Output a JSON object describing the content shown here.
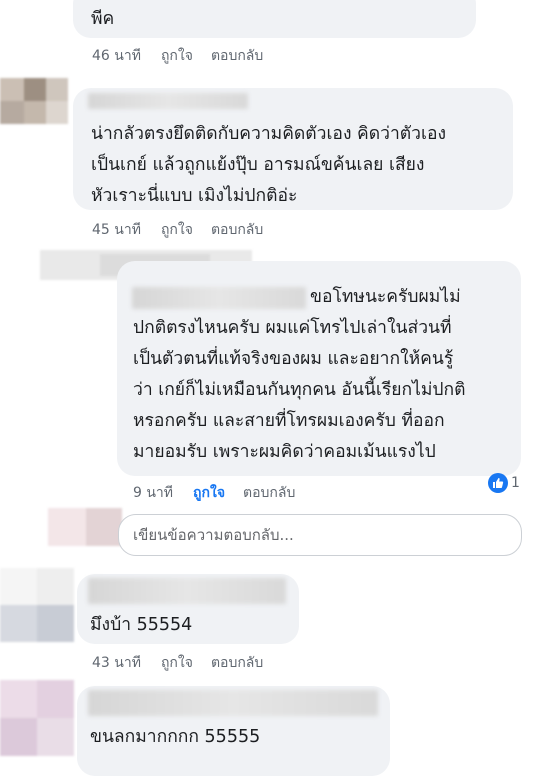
{
  "comments": [
    {
      "lines": [
        "พีค"
      ],
      "time": "46 นาที",
      "like": "ถูกใจ",
      "reply": "ตอบกลับ"
    },
    {
      "lines": [
        "น่ากลัวตรงยึดติดกับความคิดตัวเอง  คิดว่าตัวเอง",
        "เป็นเกย์ แล้วถูกแย้งปุ๊บ อารมณ์ขค้นเลย เสียง",
        "หัวเราะนี่แบบ  เมิงไม่ปกติอ่ะ"
      ],
      "time": "45 นาที",
      "like": "ถูกใจ",
      "reply": "ตอบกลับ"
    },
    {
      "lines": [
        "ขอโทษนะครับผมไม่",
        "ปกติตรงไหนครับ ผมแค่โทรไปเล่าในส่วนที่",
        "เป็นตัวตนที่แท้จริงของผม และอยากให้คนรู้",
        "ว่า เกย์ก็ไม่เหมือนกันทุกคน อันนี้เรียกไม่ปกติ",
        "หรอกครับ และสายที่โทรผมเองครับ ที่ออก",
        "มายอมรับ เพราะผมคิดว่าคอมเม้นแรงไป"
      ],
      "time": "9 นาที",
      "like": "ถูกใจ",
      "reply": "ตอบกลับ",
      "reaction_count": "1",
      "reaction_icon": "like-icon"
    },
    {
      "lines": [
        "มึงบ้า 55554"
      ],
      "time": "43 นาที",
      "like": "ถูกใจ",
      "reply": "ตอบกลับ"
    },
    {
      "lines": [
        "ขนลกมากกกก 55555"
      ]
    }
  ],
  "reply_box": {
    "placeholder": "เขียนข้อความตอบกลับ..."
  },
  "colors": {
    "bubble": "#f0f2f5",
    "link_blue": "#1877f2",
    "meta_gray": "#606770"
  }
}
